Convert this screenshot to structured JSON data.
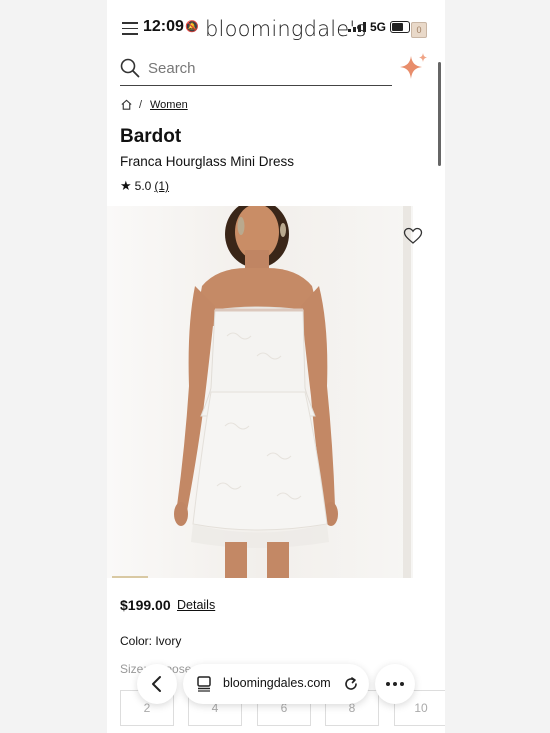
{
  "status_bar": {
    "time": "12:09",
    "network": "5G"
  },
  "header": {
    "logo": "bloomingdale's"
  },
  "search": {
    "placeholder": "Search"
  },
  "breadcrumb": {
    "items": [
      "Women"
    ]
  },
  "product": {
    "brand": "Bardot",
    "name": "Franca Hourglass Mini Dress",
    "rating": "5.0",
    "review_count": "(1)",
    "price": "$199.00",
    "details_label": "Details",
    "color_label": "Color: Ivory",
    "size_label": "Size: Choose a size"
  },
  "sizes": [
    "2",
    "4",
    "6",
    "8",
    "10"
  ],
  "browser_bar": {
    "url": "bloomingdales.com"
  },
  "icons": {
    "menu": "hamburger-icon",
    "search": "search-icon",
    "sparkle": "sparkle-icon",
    "home": "home-icon",
    "favorite": "heart-icon",
    "back": "back-arrow-icon",
    "more": "more-icon"
  },
  "colors": {
    "accent": "#e88d6b",
    "text": "#111111",
    "muted": "#777777"
  }
}
